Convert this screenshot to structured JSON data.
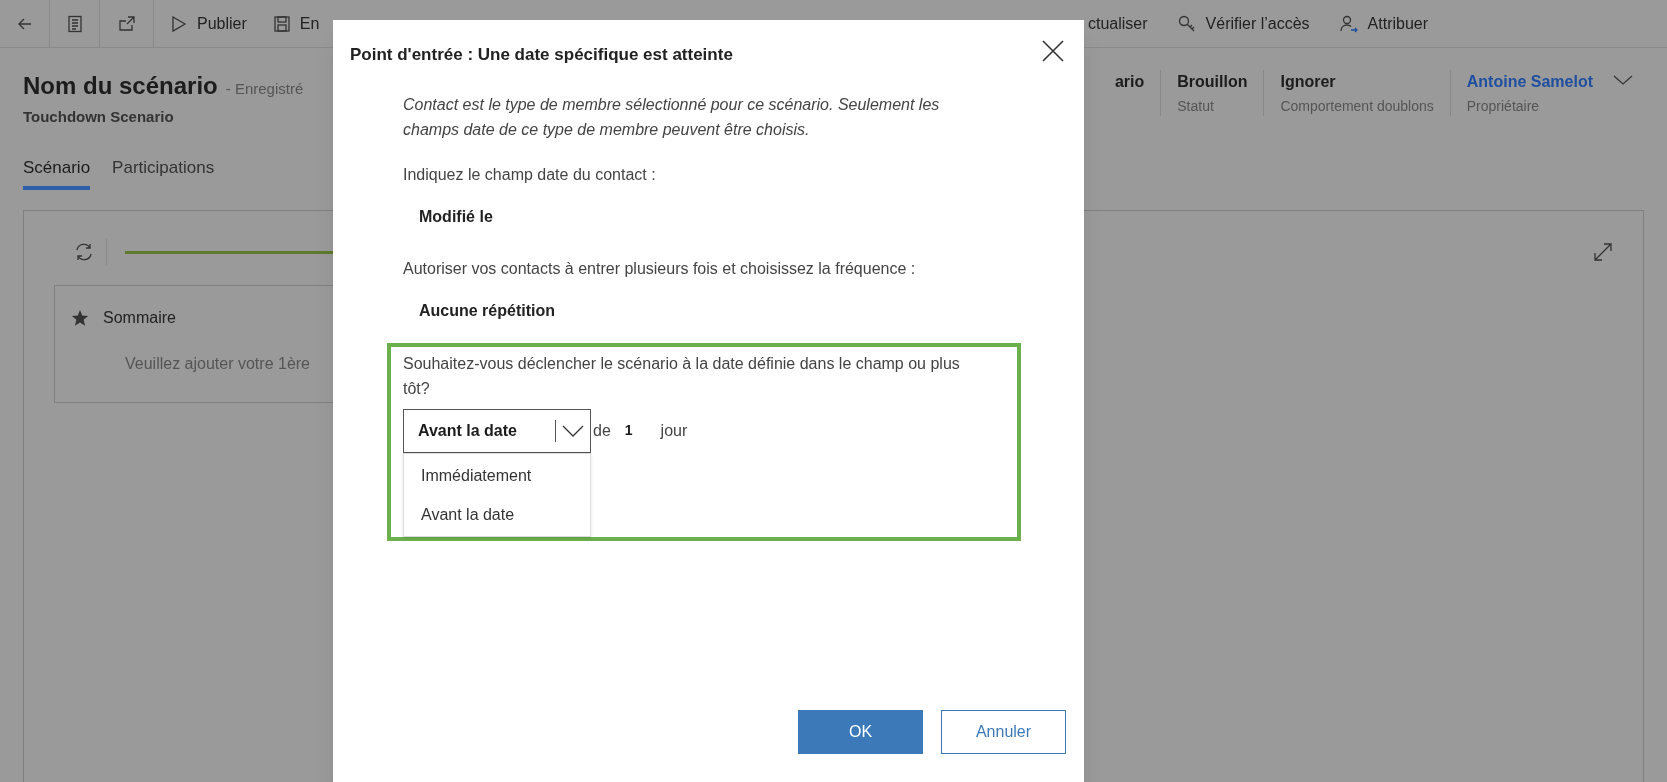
{
  "toolbar_left": [
    "Publier",
    "En"
  ],
  "toolbar_right": [
    "ctualiser",
    "Vérifier l’accès",
    "Attribuer"
  ],
  "header": {
    "title": "Nom du scénario",
    "save_state": "- Enregistré",
    "subtitle": "Touchdown Scenario"
  },
  "header_fields": [
    {
      "kind": "text",
      "value": "ario"
    },
    {
      "kind": "text",
      "value": "Brouillon",
      "label": "Statut"
    },
    {
      "kind": "text",
      "value": "Ignorer",
      "label": "Comportement doublons"
    },
    {
      "kind": "link",
      "value": "Antoine Samelot",
      "label": "Propriétaire"
    }
  ],
  "tabs": [
    {
      "label": "Scénario",
      "selected": true
    },
    {
      "label": "Participations",
      "selected": false
    }
  ],
  "summary_card": {
    "title": "Sommaire",
    "message": "Veuillez ajouter votre 1ère"
  },
  "dialog": {
    "title": "Point d'entrée : Une date spécifique est atteinte",
    "note": "Contact est le type de membre sélectionné pour ce scénario. Seulement les champs date de ce type de membre peuvent être choisis.",
    "date_field_label": "Indiquez le champ date du contact :",
    "date_field_value": "Modifié le",
    "repeat_label": "Autoriser vos contacts à entrer plusieurs fois et choisissez la fréquence :",
    "repeat_value": "Aucune répétition",
    "trigger_question": "Souhaitez-vous déclencher le scénario à la date définie dans le champ ou plus tôt?",
    "timing": {
      "value": "Avant la date",
      "expanded": true,
      "options": [
        "Immédiatement",
        "Avant la date"
      ]
    },
    "offset_prefix": "de",
    "offset_value": "1",
    "offset_unit": "jour",
    "buttons": [
      {
        "label": "OK",
        "kind": "primary"
      },
      {
        "label": "Annuler",
        "kind": "secondary"
      }
    ]
  }
}
